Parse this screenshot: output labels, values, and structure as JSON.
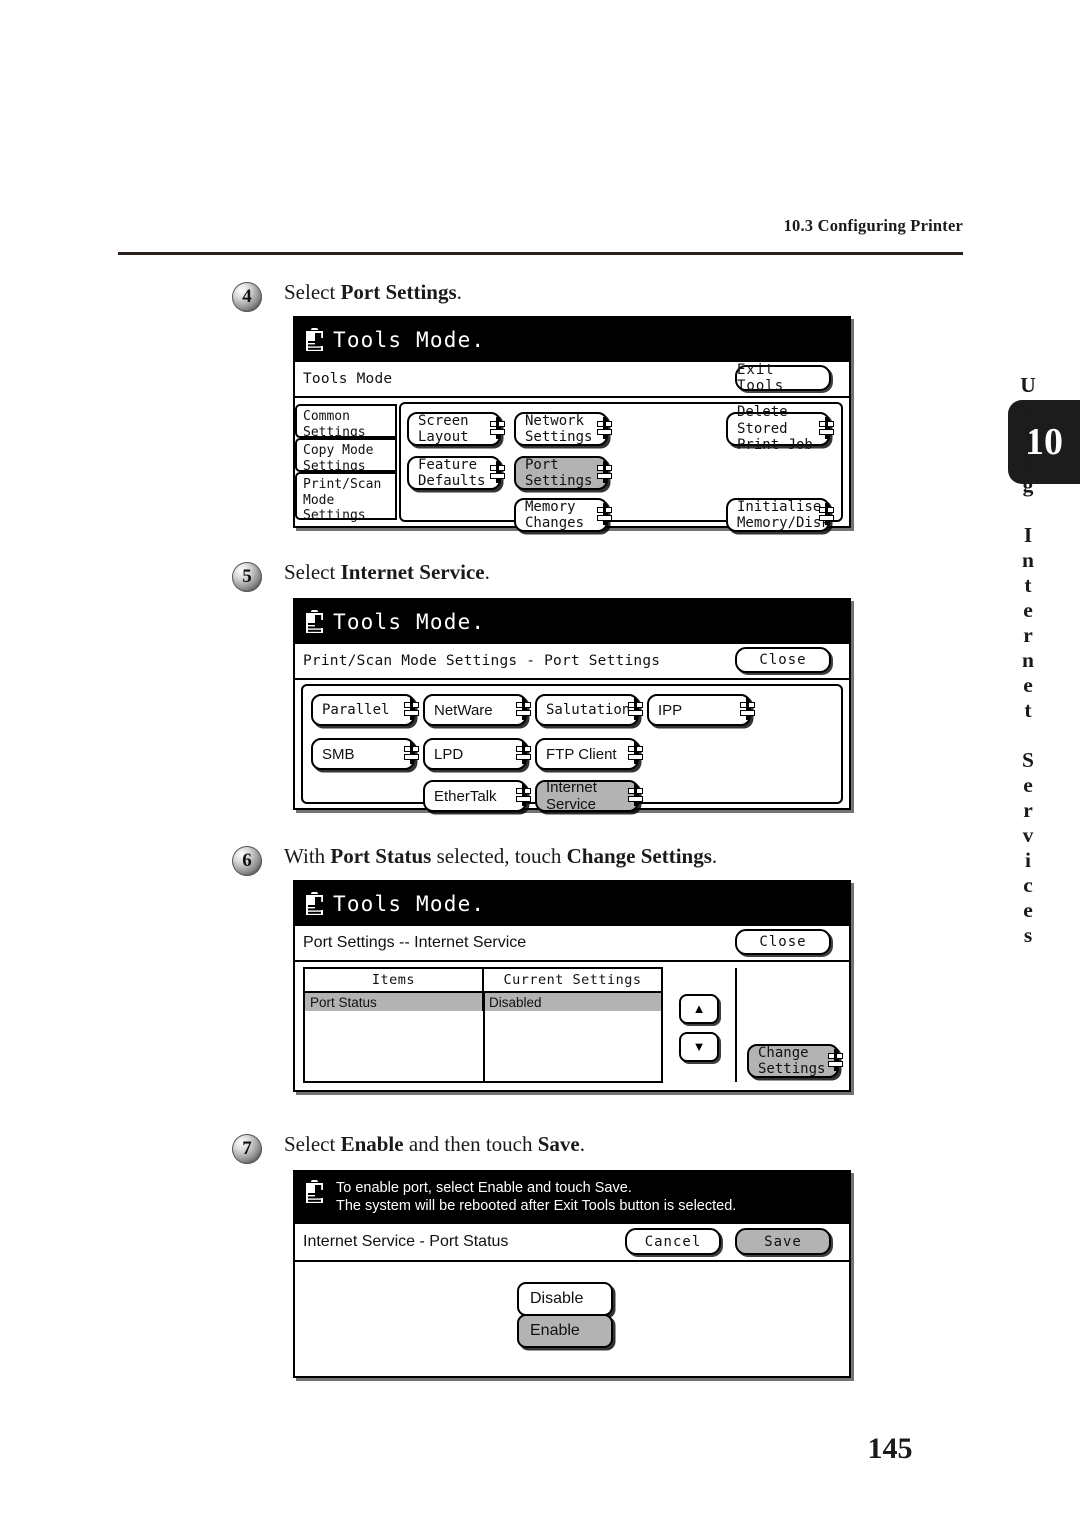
{
  "running_header": "10.3 Configuring Printer",
  "chapter_tab": {
    "number": "10",
    "title": "Using Internet Services"
  },
  "folio": "145",
  "icons": {
    "tools": "clipboard-hand-icon",
    "submenu": "submenu-indicator-icon",
    "up": "▲",
    "down": "▼"
  },
  "steps": [
    {
      "num": "4",
      "text_before": "Select ",
      "text_bold": "Port Settings",
      "text_after": ".",
      "panel": {
        "title": "Tools Mode.",
        "subbar_label": "Tools Mode",
        "subbar_button": "Exit Tools",
        "side_tabs": [
          "Common\nSettings",
          "Copy Mode\nSettings",
          "Print/Scan\nMode Settings"
        ],
        "buttons": [
          {
            "label": "Screen Layout",
            "selected": false
          },
          {
            "label": "Network\nSettings",
            "selected": false
          },
          {
            "label": "Delete Stored\nPrint Job",
            "selected": false
          },
          {
            "label": "Feature\nDefaults",
            "selected": false
          },
          {
            "label": "Port\nSettings",
            "selected": true
          },
          {
            "label": "Memory\nChanges",
            "selected": false
          },
          {
            "label": "Initialise\nMemory/Disk",
            "selected": false
          }
        ]
      }
    },
    {
      "num": "5",
      "text_before": "Select ",
      "text_bold": "Internet Service",
      "text_after": ".",
      "panel": {
        "title": "Tools Mode.",
        "subbar_label": "Print/Scan Mode Settings - Port Settings",
        "subbar_button": "Close",
        "buttons": [
          {
            "label": "Parallel",
            "selected": false
          },
          {
            "label": "NetWare",
            "selected": false
          },
          {
            "label": "Salutation",
            "selected": false
          },
          {
            "label": "IPP",
            "selected": false
          },
          {
            "label": "SMB",
            "selected": false
          },
          {
            "label": "LPD",
            "selected": false
          },
          {
            "label": "FTP Client",
            "selected": false
          },
          {
            "label": "EtherTalk",
            "selected": false
          },
          {
            "label": "Internet\nService",
            "selected": true
          }
        ]
      }
    },
    {
      "num": "6",
      "text_before": "With ",
      "text_bold": "Port Status",
      "text_mid": " selected, touch ",
      "text_bold2": "Change Settings",
      "text_after": ".",
      "panel": {
        "title": "Tools Mode.",
        "subbar_label": "Port Settings -- Internet Service",
        "subbar_button": "Close",
        "table": {
          "headers": [
            "Items",
            "Current Settings"
          ],
          "rows": [
            [
              "Port Status",
              "Disabled"
            ]
          ]
        },
        "scroll_up": "▲",
        "scroll_down": "▼",
        "change_button": "Change\nSettings"
      }
    },
    {
      "num": "7",
      "text_before": "Select ",
      "text_bold": "Enable",
      "text_mid": " and then touch ",
      "text_bold2": "Save",
      "text_after": ".",
      "panel": {
        "message_lines": [
          "To enable port, select Enable and touch Save.",
          "The system will be rebooted after Exit Tools button is selected."
        ],
        "subbar_label": "Internet Service - Port Status",
        "cancel_button": "Cancel",
        "save_button": "Save",
        "options": [
          {
            "label": "Disable",
            "selected": false
          },
          {
            "label": "Enable",
            "selected": true
          }
        ]
      }
    }
  ]
}
